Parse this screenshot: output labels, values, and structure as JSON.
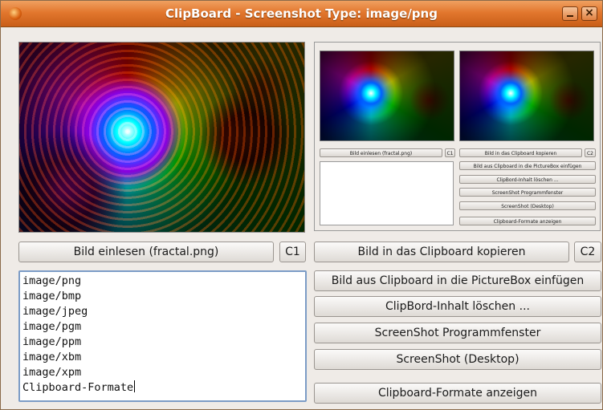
{
  "window": {
    "title": "ClipBoard - Screenshot Type: image/png"
  },
  "left": {
    "load_button": "Bild einlesen (fractal.png)",
    "c1_button": "C1",
    "formats_list": [
      "image/png",
      "image/bmp",
      "image/jpeg",
      "image/pgm",
      "image/ppm",
      "image/xbm",
      "image/xpm",
      "Clipboard-Formate"
    ]
  },
  "right": {
    "copy_button": "Bild in das Clipboard kopieren",
    "c2_button": "C2",
    "paste_button": "Bild aus Clipboard in die PictureBox einfügen",
    "clear_button": "ClipBord-Inhalt löschen ...",
    "screenshot_window_button": "ScreenShot Programmfenster",
    "screenshot_desktop_button": "ScreenShot (Desktop)",
    "show_formats_button": "Clipboard-Formate anzeigen"
  },
  "thumbnail": {
    "load_button": "Bild einlesen (fractal.png)",
    "c1_button": "C1",
    "copy_button": "Bild in das Clipboard kopieren",
    "c2_button": "C2",
    "paste_button": "Bild aus Clipboard in die PictureBox einfügen",
    "clear_button": "ClipBord-Inhalt löschen ...",
    "screenshot_window_button": "ScreenShot Programmfenster",
    "screenshot_desktop_button": "ScreenShot (Desktop)",
    "show_formats_button": "Clipboard-Formate anzeigen"
  },
  "colors": {
    "titlebar": "#e2772e",
    "window_bg": "#efebe7",
    "list_border": "#7c9cc6"
  }
}
